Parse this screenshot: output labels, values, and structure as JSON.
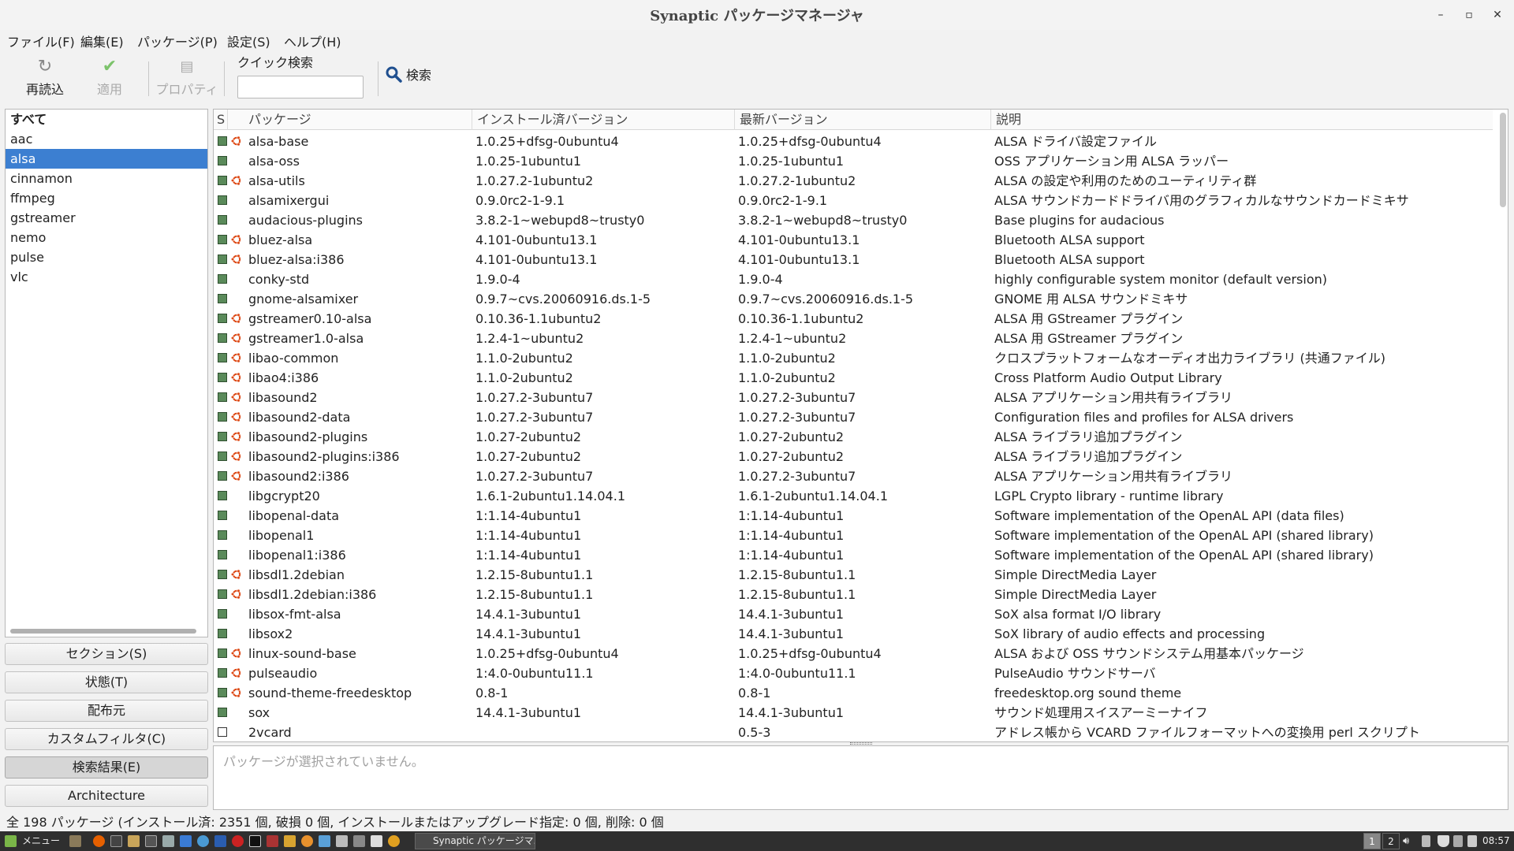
{
  "window": {
    "title": "Synaptic パッケージマネージャ",
    "controls": [
      "–",
      "▫",
      "✕"
    ]
  },
  "menu": [
    "ファイル(F)",
    "編集(E)",
    "パッケージ(P)",
    "設定(S)",
    "ヘルプ(H)"
  ],
  "toolbar": {
    "reload": "再読込",
    "apply": "適用",
    "properties": "プロパティ",
    "quick_search_label": "クイック検索",
    "quick_search_value": "",
    "search": "検索"
  },
  "filters": {
    "items": [
      "すべて",
      "aac",
      "alsa",
      "cinnamon",
      "ffmpeg",
      "gstreamer",
      "nemo",
      "pulse",
      "vlc"
    ],
    "selected": "alsa"
  },
  "category_buttons": [
    "セクション(S)",
    "状態(T)",
    "配布元",
    "カスタムフィルタ(C)",
    "検索結果(E)",
    "Architecture"
  ],
  "table": {
    "headers": {
      "status": "S",
      "package": "パッケージ",
      "installed": "インストール済バージョン",
      "latest": "最新バージョン",
      "description": "説明"
    },
    "rows": [
      {
        "installed_mark": true,
        "ubuntu": true,
        "name": "alsa-base",
        "inst": "1.0.25+dfsg-0ubuntu4",
        "latest": "1.0.25+dfsg-0ubuntu4",
        "desc": "ALSA ドライバ設定ファイル"
      },
      {
        "installed_mark": true,
        "ubuntu": false,
        "name": "alsa-oss",
        "inst": "1.0.25-1ubuntu1",
        "latest": "1.0.25-1ubuntu1",
        "desc": "OSS アプリケーション用 ALSA ラッパー"
      },
      {
        "installed_mark": true,
        "ubuntu": true,
        "name": "alsa-utils",
        "inst": "1.0.27.2-1ubuntu2",
        "latest": "1.0.27.2-1ubuntu2",
        "desc": "ALSA の設定や利用のためのユーティリティ群"
      },
      {
        "installed_mark": true,
        "ubuntu": false,
        "name": "alsamixergui",
        "inst": "0.9.0rc2-1-9.1",
        "latest": "0.9.0rc2-1-9.1",
        "desc": "ALSA サウンドカードドライバ用のグラフィカルなサウンドカードミキサ"
      },
      {
        "installed_mark": true,
        "ubuntu": false,
        "name": "audacious-plugins",
        "inst": "3.8.2-1~webupd8~trusty0",
        "latest": "3.8.2-1~webupd8~trusty0",
        "desc": "Base plugins for audacious"
      },
      {
        "installed_mark": true,
        "ubuntu": true,
        "name": "bluez-alsa",
        "inst": "4.101-0ubuntu13.1",
        "latest": "4.101-0ubuntu13.1",
        "desc": "Bluetooth ALSA support"
      },
      {
        "installed_mark": true,
        "ubuntu": true,
        "name": "bluez-alsa:i386",
        "inst": "4.101-0ubuntu13.1",
        "latest": "4.101-0ubuntu13.1",
        "desc": "Bluetooth ALSA support"
      },
      {
        "installed_mark": true,
        "ubuntu": false,
        "name": "conky-std",
        "inst": "1.9.0-4",
        "latest": "1.9.0-4",
        "desc": "highly configurable system monitor (default version)"
      },
      {
        "installed_mark": true,
        "ubuntu": false,
        "name": "gnome-alsamixer",
        "inst": "0.9.7~cvs.20060916.ds.1-5",
        "latest": "0.9.7~cvs.20060916.ds.1-5",
        "desc": "GNOME 用 ALSA サウンドミキサ"
      },
      {
        "installed_mark": true,
        "ubuntu": true,
        "name": "gstreamer0.10-alsa",
        "inst": "0.10.36-1.1ubuntu2",
        "latest": "0.10.36-1.1ubuntu2",
        "desc": "ALSA 用 GStreamer プラグイン"
      },
      {
        "installed_mark": true,
        "ubuntu": true,
        "name": "gstreamer1.0-alsa",
        "inst": "1.2.4-1~ubuntu2",
        "latest": "1.2.4-1~ubuntu2",
        "desc": "ALSA 用 GStreamer プラグイン"
      },
      {
        "installed_mark": true,
        "ubuntu": true,
        "name": "libao-common",
        "inst": "1.1.0-2ubuntu2",
        "latest": "1.1.0-2ubuntu2",
        "desc": "クロスプラットフォームなオーディオ出力ライブラリ (共通ファイル)"
      },
      {
        "installed_mark": true,
        "ubuntu": true,
        "name": "libao4:i386",
        "inst": "1.1.0-2ubuntu2",
        "latest": "1.1.0-2ubuntu2",
        "desc": "Cross Platform Audio Output Library"
      },
      {
        "installed_mark": true,
        "ubuntu": true,
        "name": "libasound2",
        "inst": "1.0.27.2-3ubuntu7",
        "latest": "1.0.27.2-3ubuntu7",
        "desc": "ALSA アプリケーション用共有ライブラリ"
      },
      {
        "installed_mark": true,
        "ubuntu": true,
        "name": "libasound2-data",
        "inst": "1.0.27.2-3ubuntu7",
        "latest": "1.0.27.2-3ubuntu7",
        "desc": "Configuration files and profiles for ALSA drivers"
      },
      {
        "installed_mark": true,
        "ubuntu": true,
        "name": "libasound2-plugins",
        "inst": "1.0.27-2ubuntu2",
        "latest": "1.0.27-2ubuntu2",
        "desc": "ALSA ライブラリ追加プラグイン"
      },
      {
        "installed_mark": true,
        "ubuntu": true,
        "name": "libasound2-plugins:i386",
        "inst": "1.0.27-2ubuntu2",
        "latest": "1.0.27-2ubuntu2",
        "desc": "ALSA ライブラリ追加プラグイン"
      },
      {
        "installed_mark": true,
        "ubuntu": true,
        "name": "libasound2:i386",
        "inst": "1.0.27.2-3ubuntu7",
        "latest": "1.0.27.2-3ubuntu7",
        "desc": "ALSA アプリケーション用共有ライブラリ"
      },
      {
        "installed_mark": true,
        "ubuntu": false,
        "name": "libgcrypt20",
        "inst": "1.6.1-2ubuntu1.14.04.1",
        "latest": "1.6.1-2ubuntu1.14.04.1",
        "desc": "LGPL Crypto library - runtime library"
      },
      {
        "installed_mark": true,
        "ubuntu": false,
        "name": "libopenal-data",
        "inst": "1:1.14-4ubuntu1",
        "latest": "1:1.14-4ubuntu1",
        "desc": "Software implementation of the OpenAL API (data files)"
      },
      {
        "installed_mark": true,
        "ubuntu": false,
        "name": "libopenal1",
        "inst": "1:1.14-4ubuntu1",
        "latest": "1:1.14-4ubuntu1",
        "desc": "Software implementation of the OpenAL API (shared library)"
      },
      {
        "installed_mark": true,
        "ubuntu": false,
        "name": "libopenal1:i386",
        "inst": "1:1.14-4ubuntu1",
        "latest": "1:1.14-4ubuntu1",
        "desc": "Software implementation of the OpenAL API (shared library)"
      },
      {
        "installed_mark": true,
        "ubuntu": true,
        "name": "libsdl1.2debian",
        "inst": "1.2.15-8ubuntu1.1",
        "latest": "1.2.15-8ubuntu1.1",
        "desc": "Simple DirectMedia Layer"
      },
      {
        "installed_mark": true,
        "ubuntu": true,
        "name": "libsdl1.2debian:i386",
        "inst": "1.2.15-8ubuntu1.1",
        "latest": "1.2.15-8ubuntu1.1",
        "desc": "Simple DirectMedia Layer"
      },
      {
        "installed_mark": true,
        "ubuntu": false,
        "name": "libsox-fmt-alsa",
        "inst": "14.4.1-3ubuntu1",
        "latest": "14.4.1-3ubuntu1",
        "desc": "SoX alsa format I/O library"
      },
      {
        "installed_mark": true,
        "ubuntu": false,
        "name": "libsox2",
        "inst": "14.4.1-3ubuntu1",
        "latest": "14.4.1-3ubuntu1",
        "desc": "SoX library of audio effects and processing"
      },
      {
        "installed_mark": true,
        "ubuntu": true,
        "name": "linux-sound-base",
        "inst": "1.0.25+dfsg-0ubuntu4",
        "latest": "1.0.25+dfsg-0ubuntu4",
        "desc": "ALSA および OSS サウンドシステム用基本パッケージ"
      },
      {
        "installed_mark": true,
        "ubuntu": true,
        "name": "pulseaudio",
        "inst": "1:4.0-0ubuntu11.1",
        "latest": "1:4.0-0ubuntu11.1",
        "desc": "PulseAudio サウンドサーバ"
      },
      {
        "installed_mark": true,
        "ubuntu": true,
        "name": "sound-theme-freedesktop",
        "inst": "0.8-1",
        "latest": "0.8-1",
        "desc": "freedesktop.org sound theme"
      },
      {
        "installed_mark": true,
        "ubuntu": false,
        "name": "sox",
        "inst": "14.4.1-3ubuntu1",
        "latest": "14.4.1-3ubuntu1",
        "desc": "サウンド処理用スイスアーミーナイフ"
      },
      {
        "installed_mark": false,
        "ubuntu": false,
        "name": "2vcard",
        "inst": "",
        "latest": "0.5-3",
        "desc": "アドレス帳から VCARD ファイルフォーマットへの変換用 perl スクリプト"
      }
    ]
  },
  "details": {
    "placeholder": "パッケージが選択されていません。"
  },
  "status": "全 198 パッケージ (インストール済: 2351 個, 破損 0 個, インストールまたはアップグレード指定: 0 個, 削除: 0 個",
  "taskbar": {
    "menu": "メニュー",
    "window_task": "Synaptic パッケージマ...",
    "workspaces": [
      "1",
      "2"
    ],
    "clock": "08:57"
  },
  "colors": {
    "selection": "#3c7fd1",
    "installed_box": "#5a8a5a",
    "ubuntu_mark": "#dd4814"
  }
}
